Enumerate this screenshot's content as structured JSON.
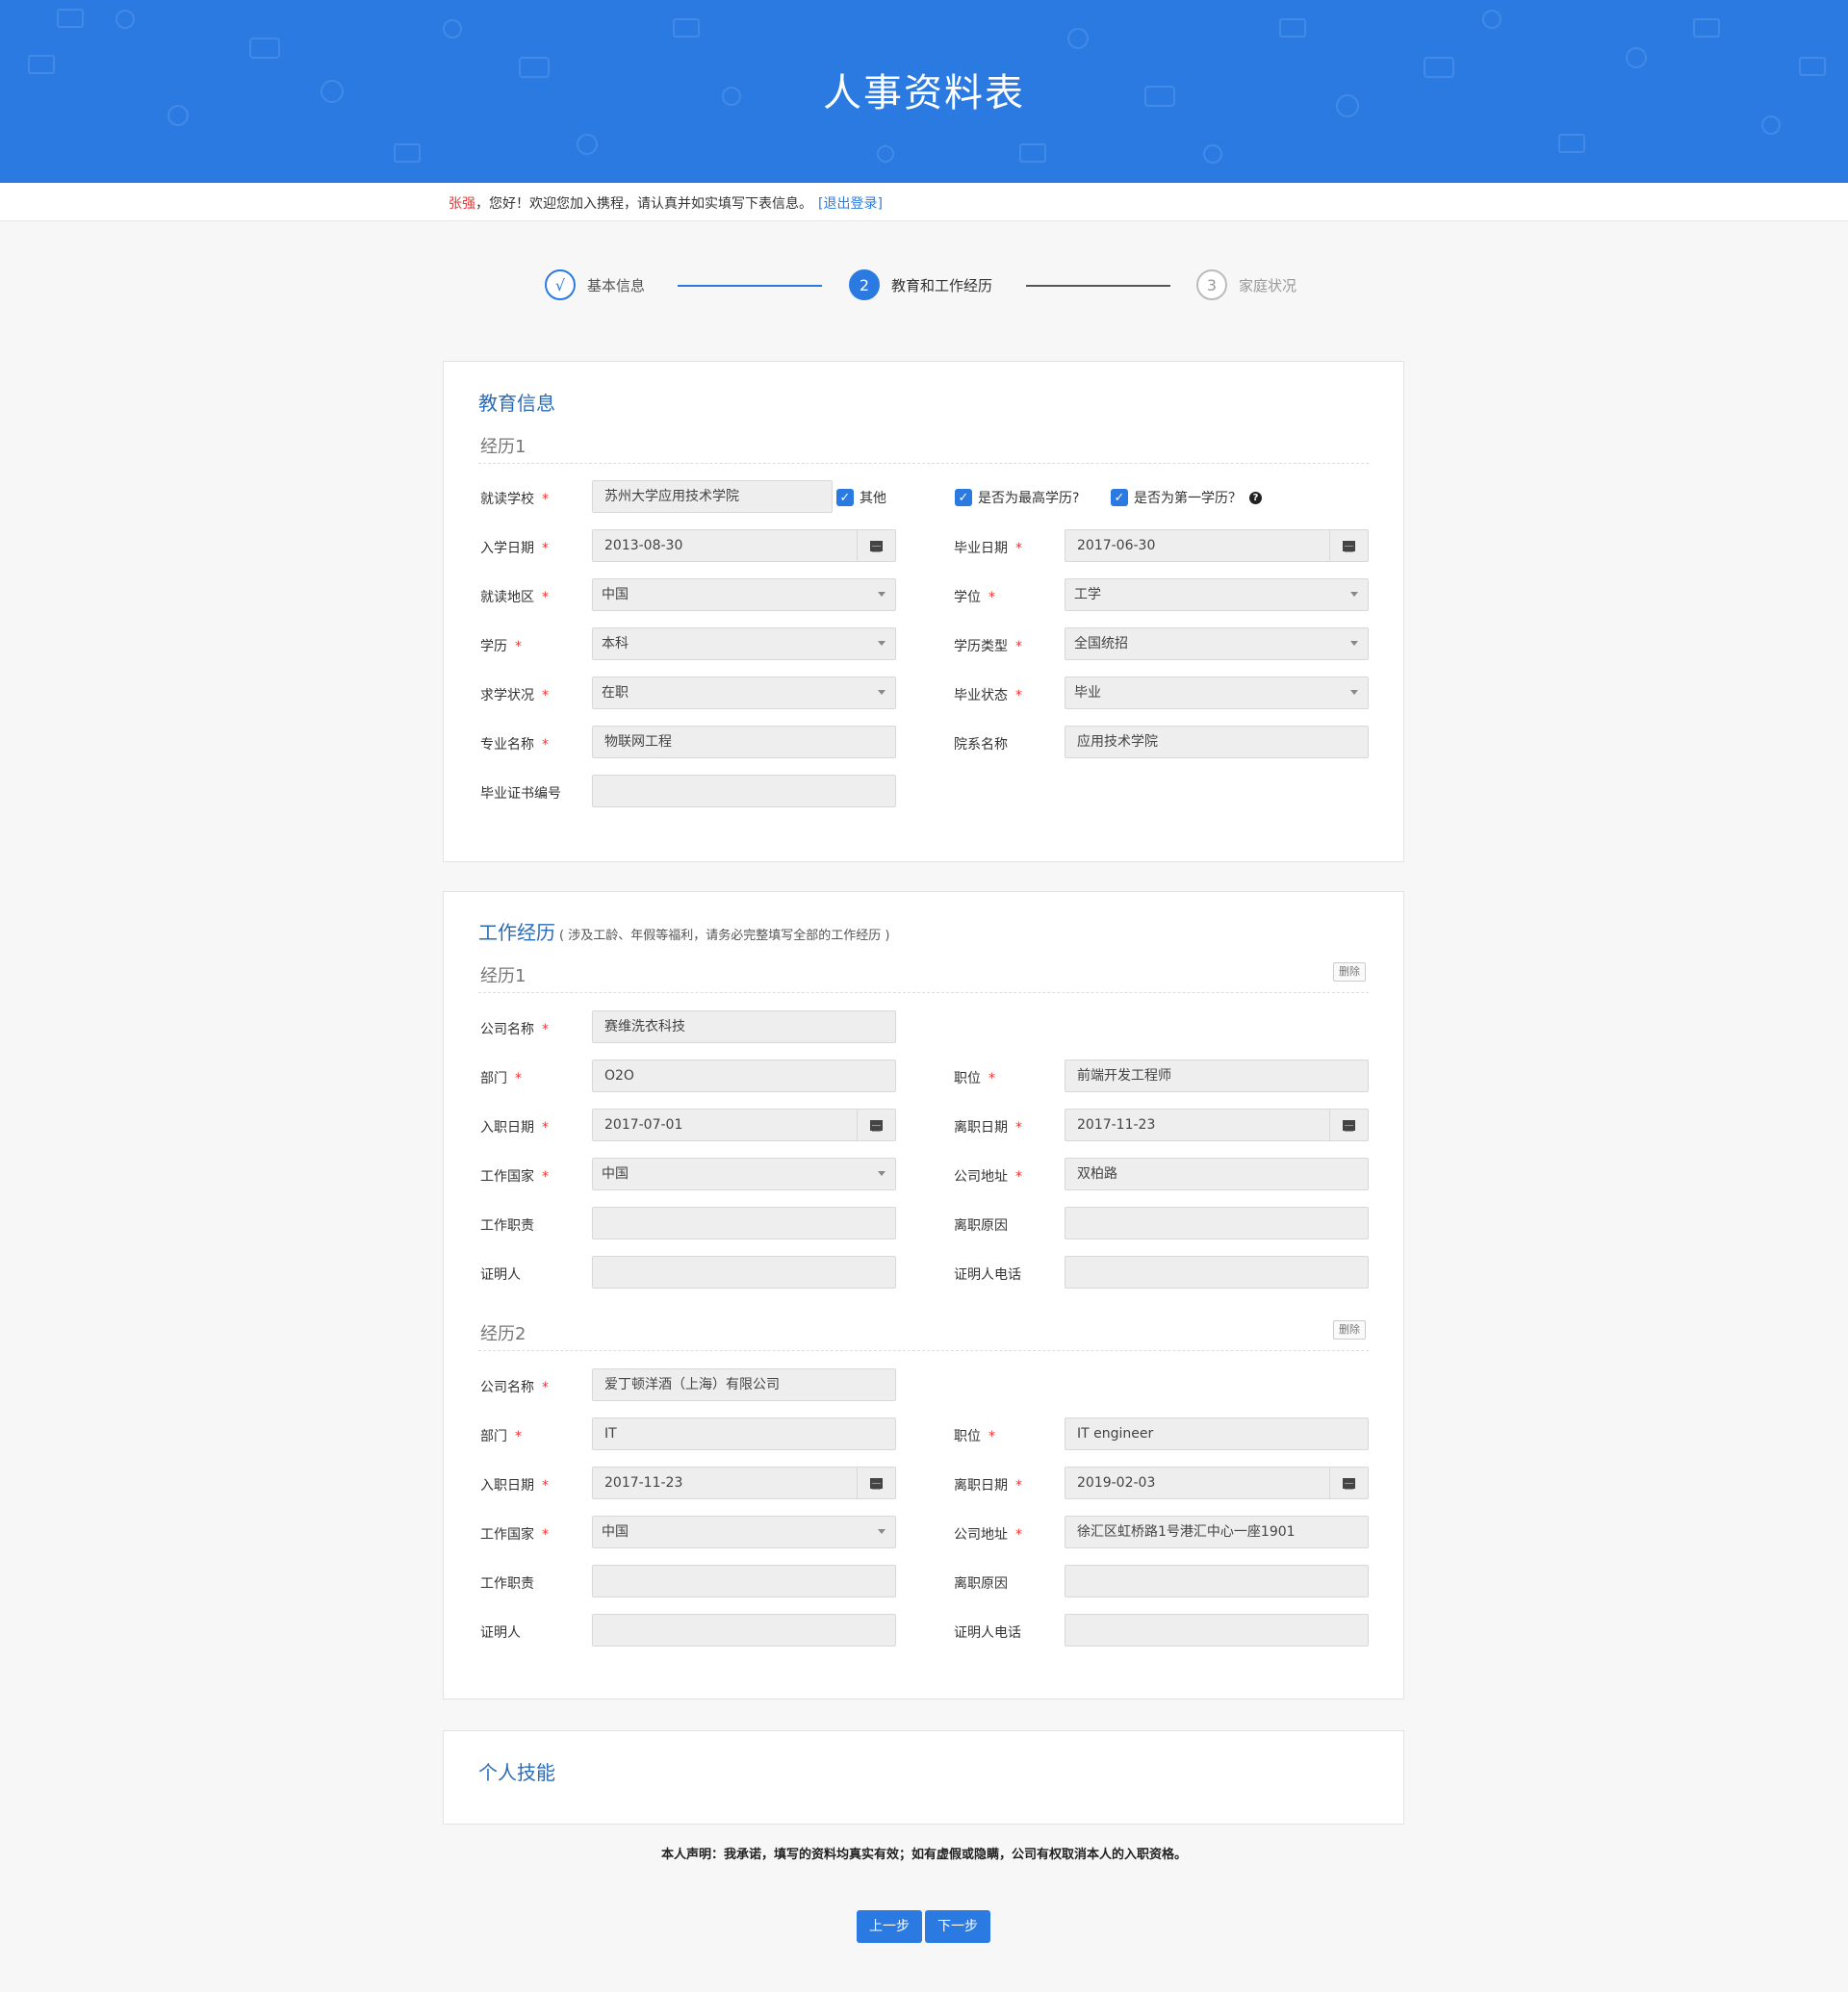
{
  "header": {
    "title": "人事资料表"
  },
  "welcome": {
    "user": "张强",
    "message": "，您好！欢迎您加入携程，请认真并如实填写下表信息。",
    "logout": "[退出登录]"
  },
  "steps": [
    {
      "num": "√",
      "label": "基本信息",
      "state": "done"
    },
    {
      "num": "2",
      "label": "教育和工作经历",
      "state": "active"
    },
    {
      "num": "3",
      "label": "家庭状况",
      "state": "todo"
    }
  ],
  "education": {
    "title": "教育信息",
    "exp_title": "经历1",
    "school": {
      "label": "就读学校",
      "value": "苏州大学应用技术学院"
    },
    "other_cb": "其他",
    "highest_cb": "是否为最高学历?",
    "first_cb": "是否为第一学历？",
    "help_icon": "?",
    "start": {
      "label": "入学日期",
      "value": "2013-08-30"
    },
    "grad": {
      "label": "毕业日期",
      "value": "2017-06-30"
    },
    "region": {
      "label": "就读地区",
      "value": "中国"
    },
    "degree": {
      "label": "学位",
      "value": "工学"
    },
    "edu": {
      "label": "学历",
      "value": "本科"
    },
    "edu_type": {
      "label": "学历类型",
      "value": "全国统招"
    },
    "study_status": {
      "label": "求学状况",
      "value": "在职"
    },
    "grad_status": {
      "label": "毕业状态",
      "value": "毕业"
    },
    "major": {
      "label": "专业名称",
      "value": "物联网工程"
    },
    "dept": {
      "label": "院系名称",
      "value": "应用技术学院"
    },
    "cert": {
      "label": "毕业证书编号",
      "value": ""
    }
  },
  "work": {
    "title": "工作经历",
    "note": "( 涉及工龄、年假等福利，请务必完整填写全部的工作经历 )",
    "delete_label": "删除",
    "labels": {
      "company": "公司名称",
      "dept": "部门",
      "position": "职位",
      "start": "入职日期",
      "end": "离职日期",
      "country": "工作国家",
      "address": "公司地址",
      "duty": "工作职责",
      "reason": "离职原因",
      "witness": "证明人",
      "witness_phone": "证明人电话"
    },
    "exp1": {
      "title": "经历1",
      "company": "赛维洗衣科技",
      "dept": "O2O",
      "position": "前端开发工程师",
      "start": "2017-07-01",
      "end": "2017-11-23",
      "country": "中国",
      "address": "双柏路",
      "duty": "",
      "reason": "",
      "witness": "",
      "witness_phone": ""
    },
    "exp2": {
      "title": "经历2",
      "company": "爱丁顿洋酒（上海）有限公司",
      "dept": "IT",
      "position": "IT engineer",
      "start": "2017-11-23",
      "end": "2019-02-03",
      "country": "中国",
      "address": "徐汇区虹桥路1号港汇中心一座1901",
      "duty": "",
      "reason": "",
      "witness": "",
      "witness_phone": ""
    }
  },
  "skills": {
    "title": "个人技能"
  },
  "declaration": "本人声明：我承诺，填写的资料均真实有效；如有虚假或隐瞒，公司有权取消本人的入职资格。",
  "buttons": {
    "prev": "上一步",
    "next": "下一步"
  },
  "colors": {
    "primary": "#2a7ae2",
    "required": "#e33"
  }
}
